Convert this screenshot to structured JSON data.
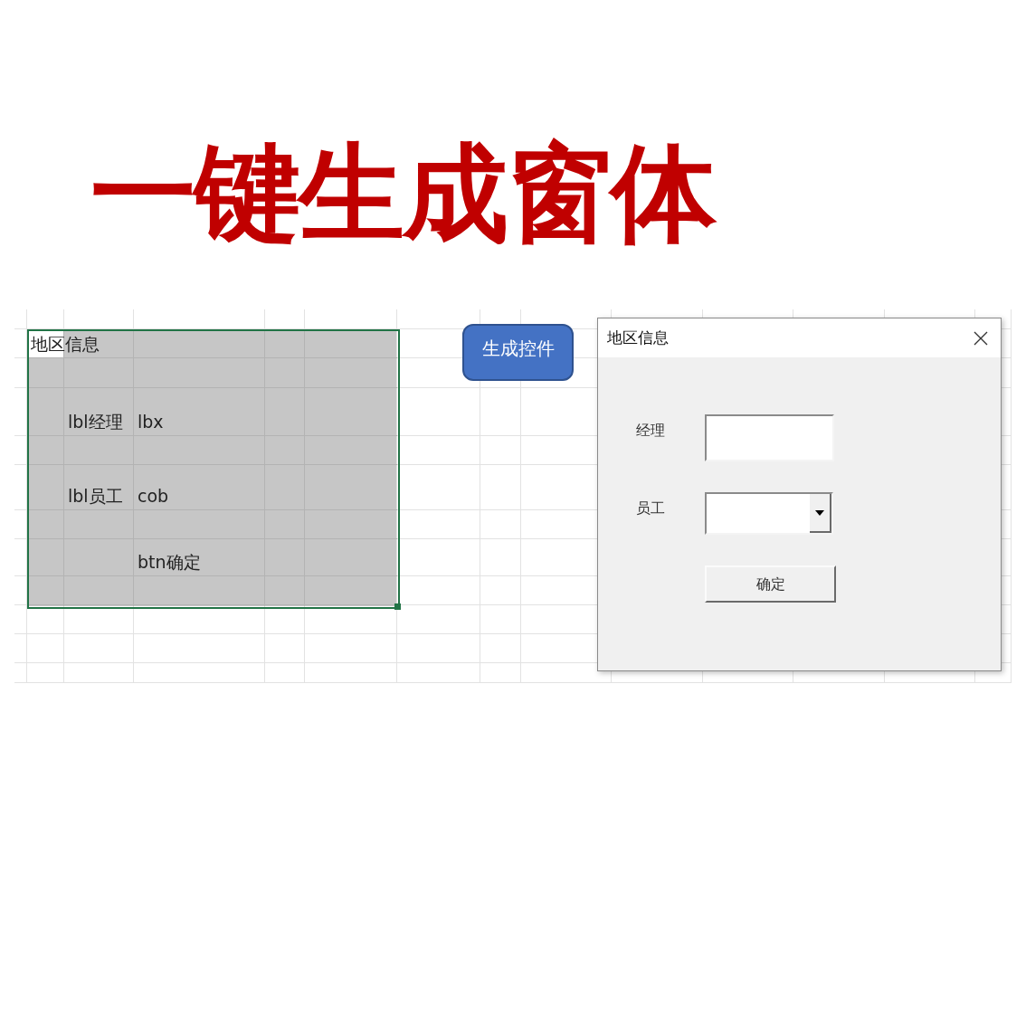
{
  "headline": "一键生成窗体",
  "sheet": {
    "selection": {
      "rows": [
        {
          "column_1": "地区信息"
        },
        {},
        {
          "column_2": "lbl经理",
          "column_3": "lbx"
        },
        {},
        {
          "column_2": "lbl员工",
          "column_3": "cob"
        },
        {},
        {
          "column_3": "btn确定"
        },
        {}
      ]
    }
  },
  "generate_button": {
    "label": "生成控件"
  },
  "dialog": {
    "title": "地区信息",
    "fields": [
      {
        "kind": "textbox",
        "label": "经理"
      },
      {
        "kind": "combobox",
        "label": "员工"
      }
    ],
    "button": {
      "label": "确定"
    }
  }
}
